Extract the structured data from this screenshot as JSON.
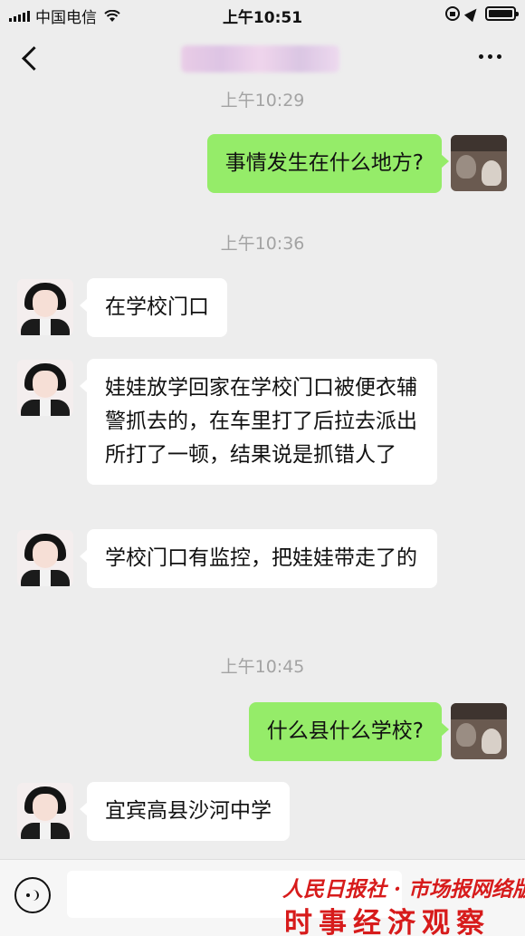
{
  "status_bar": {
    "carrier": "中国电信",
    "time": "上午10:51"
  },
  "chat": {
    "timestamps": [
      "上午10:29",
      "上午10:36",
      "上午10:45"
    ],
    "messages": [
      {
        "side": "right",
        "text": "事情发生在什么地方?"
      },
      {
        "side": "left",
        "text": "在学校门口"
      },
      {
        "side": "left",
        "text": "娃娃放学回家在学校门口被便衣辅警抓去的，在车里打了后拉去派出所打了一顿，结果说是抓错人了"
      },
      {
        "side": "left",
        "text": "学校门口有监控，把娃娃带走了的"
      },
      {
        "side": "right",
        "text": "什么县什么学校?"
      },
      {
        "side": "left",
        "text": "宜宾高县沙河中学"
      }
    ]
  },
  "watermark": {
    "top": "人民日报社 · 市场报网络版",
    "bottom": "时事经济观察"
  },
  "colors": {
    "background": "#ededed",
    "bubble_self": "#95ec69",
    "bubble_other": "#ffffff",
    "watermark": "#d71b1b"
  },
  "icons": [
    "back-icon",
    "more-icon",
    "voice-icon",
    "signal-icon",
    "wifi-icon",
    "rotation-lock-icon",
    "location-icon",
    "battery-icon"
  ]
}
